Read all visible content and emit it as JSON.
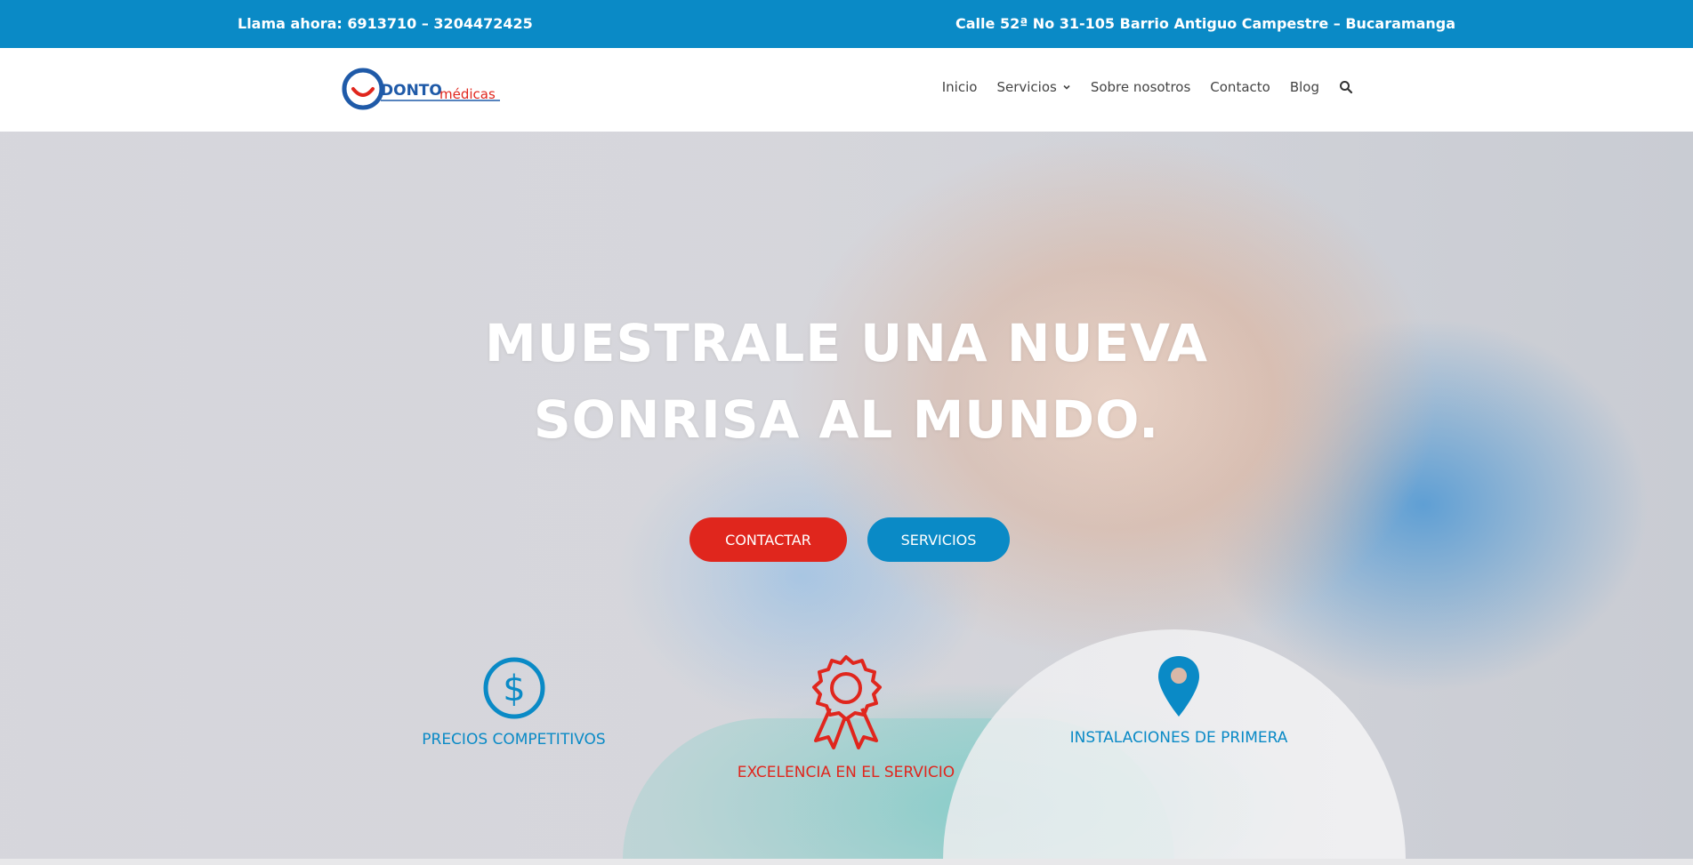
{
  "topbar": {
    "phone": "Llama ahora: 6913710 – 3204472425",
    "address": "Calle 52ª No 31-105 Barrio Antiguo Campestre – Bucaramanga"
  },
  "logo": {
    "part1": "DONTO",
    "part2": "médicas"
  },
  "nav": {
    "items": [
      {
        "label": "Inicio"
      },
      {
        "label": "Servicios"
      },
      {
        "label": "Sobre nosotros"
      },
      {
        "label": "Contacto"
      },
      {
        "label": "Blog"
      }
    ],
    "search_icon": "search-icon"
  },
  "hero": {
    "headline_line1": "MUESTRALE UNA NUEVA",
    "headline_line2": "SONRISA AL MUNDO.",
    "button_contact": "CONTACTAR",
    "button_services": "SERVICIOS"
  },
  "features": [
    {
      "label": "PRECIOS COMPETITIVOS",
      "icon": "dollar-circle-icon"
    },
    {
      "label": "EXCELENCIA EN EL SERVICIO",
      "icon": "award-ribbon-icon"
    },
    {
      "label": "INSTALACIONES DE PRIMERA",
      "icon": "map-pin-icon"
    }
  ],
  "colors": {
    "primary_blue": "#0a8ac6",
    "accent_red": "#e0261d",
    "nav_text": "#444444"
  }
}
